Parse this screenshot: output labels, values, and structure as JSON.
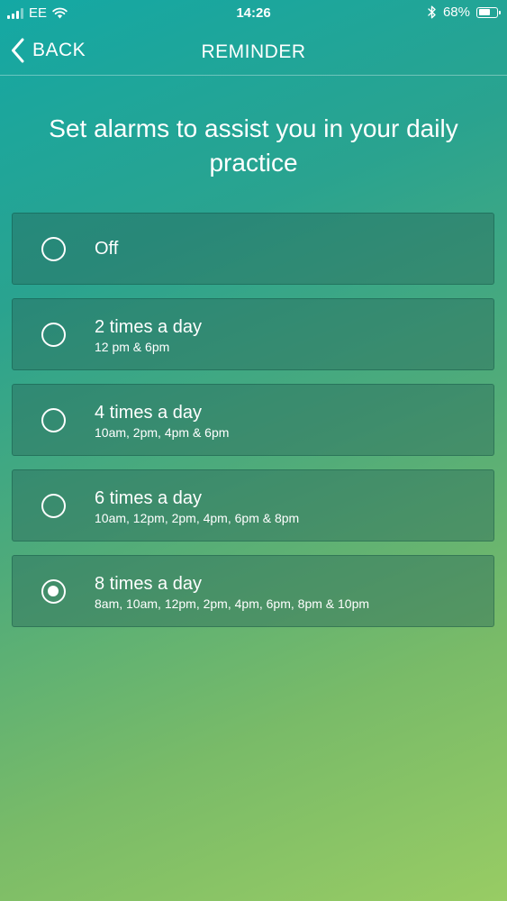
{
  "status_bar": {
    "carrier": "EE",
    "time": "14:26",
    "battery_percent": "68%",
    "battery_level": 0.68,
    "signal_bars_filled": 3,
    "signal_bars_total": 4,
    "icons": [
      "signal-icon",
      "wifi-icon",
      "bluetooth-icon",
      "battery-icon"
    ]
  },
  "nav": {
    "back_label": "BACK",
    "title": "REMINDER"
  },
  "heading": "Set alarms to assist you in your daily practice",
  "options": [
    {
      "title": "Off",
      "subtitle": "",
      "selected": false
    },
    {
      "title": "2 times a day",
      "subtitle": "12 pm & 6pm",
      "selected": false
    },
    {
      "title": "4 times a day",
      "subtitle": "10am, 2pm, 4pm & 6pm",
      "selected": false
    },
    {
      "title": "6 times a day",
      "subtitle": "10am, 12pm, 2pm, 4pm, 6pm & 8pm",
      "selected": false
    },
    {
      "title": "8 times a day",
      "subtitle": "8am, 10am, 12pm, 2pm, 4pm, 6pm, 8pm & 10pm",
      "selected": true
    }
  ],
  "colors": {
    "gradient_top": "#14a8a4",
    "gradient_bottom": "#98cc64",
    "option_background": "#286458",
    "text": "#ffffff"
  }
}
